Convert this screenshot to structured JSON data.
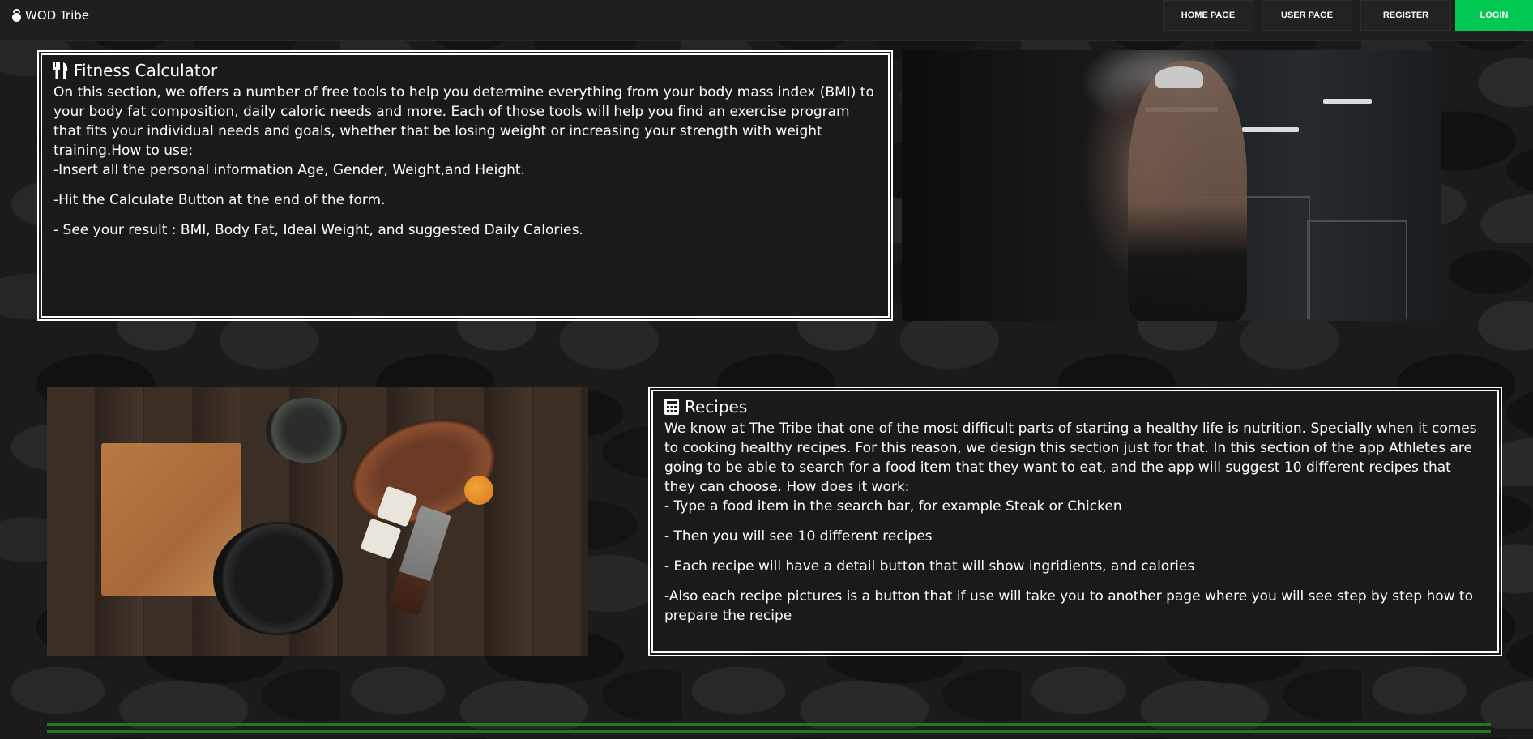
{
  "navbar": {
    "brand": "WOD Tribe",
    "brand_icon": "kettlebell-icon",
    "links": {
      "home": "HOME PAGE",
      "user": "USER PAGE",
      "register": "REGISTER",
      "login": "LOGIN"
    },
    "login_color": "#00c853"
  },
  "fitness": {
    "icon": "utensils-icon",
    "title": "Fitness Calculator",
    "intro": "On this section, we offers a number of free tools to help you determine everything from your body mass index (BMI) to your body fat composition, daily caloric needs and more. Each of those tools will help you find an exercise program that fits your individual needs and goals, whether that be losing weight or increasing your strength with weight training.How to use:",
    "steps": [
      "-Insert all the personal information Age, Gender, Weight,and Height.",
      "-Hit the Calculate Button at the end of the form.",
      "- See your result : BMI, Body Fat, Ideal Weight, and suggested Daily Calories."
    ]
  },
  "recipes": {
    "icon": "calculator-icon",
    "title": "Recipes",
    "intro": "We know at The Tribe that one of the most difficult parts of starting a healthy life is nutrition. Specially when it comes to cooking healthy recipes. For this reason, we design this section just for that. In this section of the app Athletes are going to be able to search for a food item that they want to eat, and the app will suggest 10 different recipes that they can choose. How does it work:",
    "steps": [
      "- Type a food item in the search bar, for example Steak or Chicken",
      "- Then you will see 10 different recipes",
      "- Each recipe will have a detail button that will show ingridients, and calories",
      "-Also each recipe pictures is a button that if use will take you to another page where you will see step by step how to prepare the recipe"
    ]
  },
  "footer": {
    "line_color": "#1f7a1f"
  }
}
